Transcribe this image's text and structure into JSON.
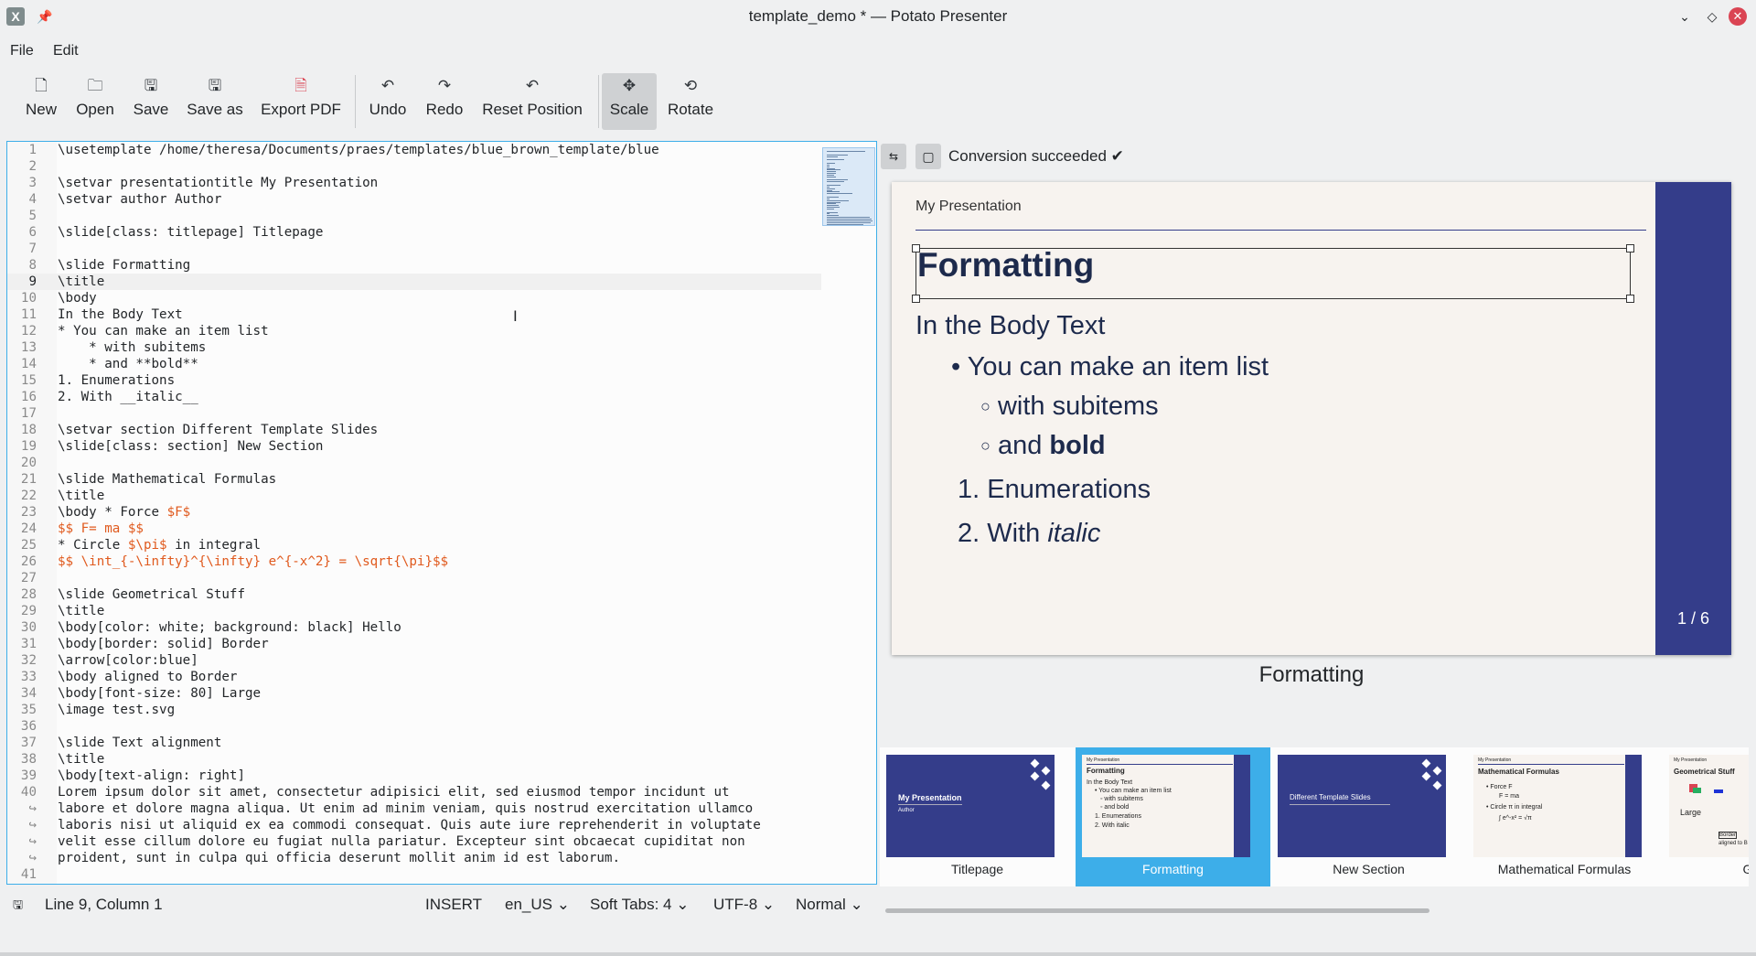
{
  "window": {
    "title": "template_demo * — Potato Presenter"
  },
  "menu": [
    "File",
    "Edit"
  ],
  "toolbar": {
    "new": "New",
    "open": "Open",
    "save": "Save",
    "save_as": "Save as",
    "export_pdf": "Export PDF",
    "undo": "Undo",
    "redo": "Redo",
    "reset_position": "Reset Position",
    "scale": "Scale",
    "rotate": "Rotate"
  },
  "editor": {
    "lines": [
      {
        "n": "1",
        "t": "\\usetemplate /home/theresa/Documents/praes/templates/blue_brown_template/blue"
      },
      {
        "n": "2",
        "t": ""
      },
      {
        "n": "3",
        "t": "\\setvar presentationtitle My Presentation"
      },
      {
        "n": "4",
        "t": "\\setvar author Author"
      },
      {
        "n": "5",
        "t": ""
      },
      {
        "n": "6",
        "t": "\\slide[class: titlepage] Titlepage"
      },
      {
        "n": "7",
        "t": ""
      },
      {
        "n": "8",
        "t": "\\slide Formatting"
      },
      {
        "n": "9",
        "t": "\\title"
      },
      {
        "n": "10",
        "t": "\\body"
      },
      {
        "n": "11",
        "t": "In the Body Text"
      },
      {
        "n": "12",
        "t": "* You can make an item list"
      },
      {
        "n": "13",
        "t": "    * with subitems"
      },
      {
        "n": "14",
        "t": "    * and **bold**"
      },
      {
        "n": "15",
        "t": "1. Enumerations"
      },
      {
        "n": "16",
        "t": "2. With __italic__"
      },
      {
        "n": "17",
        "t": ""
      },
      {
        "n": "18",
        "t": "\\setvar section Different Template Slides"
      },
      {
        "n": "19",
        "t": "\\slide[class: section] New Section"
      },
      {
        "n": "20",
        "t": ""
      },
      {
        "n": "21",
        "t": "\\slide Mathematical Formulas"
      },
      {
        "n": "22",
        "t": "\\title"
      },
      {
        "n": "23",
        "t": "\\body * Force ",
        "h": "$F$"
      },
      {
        "n": "24",
        "t": "",
        "h": "$$ F= ma $$"
      },
      {
        "n": "25",
        "t": "* Circle ",
        "h": "$\\pi$",
        "t2": " in integral"
      },
      {
        "n": "26",
        "t": "",
        "h": "$$ \\int_{-\\infty}^{\\infty} e^{-x^2} = \\sqrt{\\pi}$$"
      },
      {
        "n": "27",
        "t": ""
      },
      {
        "n": "28",
        "t": "\\slide Geometrical Stuff"
      },
      {
        "n": "29",
        "t": "\\title"
      },
      {
        "n": "30",
        "t": "\\body[color: white; background: black] Hello"
      },
      {
        "n": "31",
        "t": "\\body[border: solid] Border"
      },
      {
        "n": "32",
        "t": "\\arrow[color:blue]"
      },
      {
        "n": "33",
        "t": "\\body aligned to Border"
      },
      {
        "n": "34",
        "t": "\\body[font-size: 80] Large"
      },
      {
        "n": "35",
        "t": "\\image test.svg"
      },
      {
        "n": "36",
        "t": ""
      },
      {
        "n": "37",
        "t": "\\slide Text alignment"
      },
      {
        "n": "38",
        "t": "\\title"
      },
      {
        "n": "39",
        "t": "\\body[text-align: right]"
      },
      {
        "n": "40",
        "t": "Lorem ipsum dolor sit amet, consectetur adipisici elit, sed eiusmod tempor incidunt ut"
      },
      {
        "n": "↪",
        "t": "labore et dolore magna aliqua. Ut enim ad minim veniam, quis nostrud exercitation ullamco"
      },
      {
        "n": "↪",
        "t": "laboris nisi ut aliquid ex ea commodi consequat. Quis aute iure reprehenderit in voluptate"
      },
      {
        "n": "↪",
        "t": "velit esse cillum dolore eu fugiat nulla pariatur. Excepteur sint obcaecat cupiditat non"
      },
      {
        "n": "↪",
        "t": "proident, sunt in culpa qui officia deserunt mollit anim id est laborum."
      },
      {
        "n": "41",
        "t": ""
      }
    ]
  },
  "preview": {
    "status": "Conversion succeeded ✔",
    "slide": {
      "presentation_title": "My Presentation",
      "title": "Formatting",
      "body_heading": "In the Body Text",
      "bullet1": "You can make an item list",
      "sub1": "with subitems",
      "sub2_plain": "and ",
      "sub2_bold": "bold",
      "enum1": "1. Enumerations",
      "enum2_plain": "2. With ",
      "enum2_italic": "italic",
      "page": "1 / 6"
    },
    "caption": "Formatting"
  },
  "thumbnails": [
    {
      "label": "Titlepage",
      "title": "My Presentation",
      "subtitle": "Author"
    },
    {
      "label": "Formatting",
      "head": "My Presentation",
      "title": "Formatting",
      "lines": [
        "In the Body Text",
        "• You can make an item list",
        "◦ with subitems",
        "◦ and bold",
        "1. Enumerations",
        "2. With italic"
      ],
      "selected": true
    },
    {
      "label": "New Section",
      "title": "Different Template Slides"
    },
    {
      "label": "Mathematical Formulas",
      "head": "My Presentation",
      "title": "Mathematical Formulas",
      "lines": [
        "• Force F",
        "F = ma",
        "• Circle π in integral",
        "∫ e^-x² = √π"
      ]
    },
    {
      "label": "Geom",
      "head": "My Presentation",
      "title": "Geometrical Stuff",
      "lines": [
        "Large",
        "Border",
        "aligned to B"
      ]
    }
  ],
  "statusbar": {
    "position": "Line 9, Column 1",
    "mode": "INSERT",
    "language": "en_US",
    "tabs": "Soft Tabs: 4",
    "encoding": "UTF-8",
    "input_mode": "Normal"
  }
}
